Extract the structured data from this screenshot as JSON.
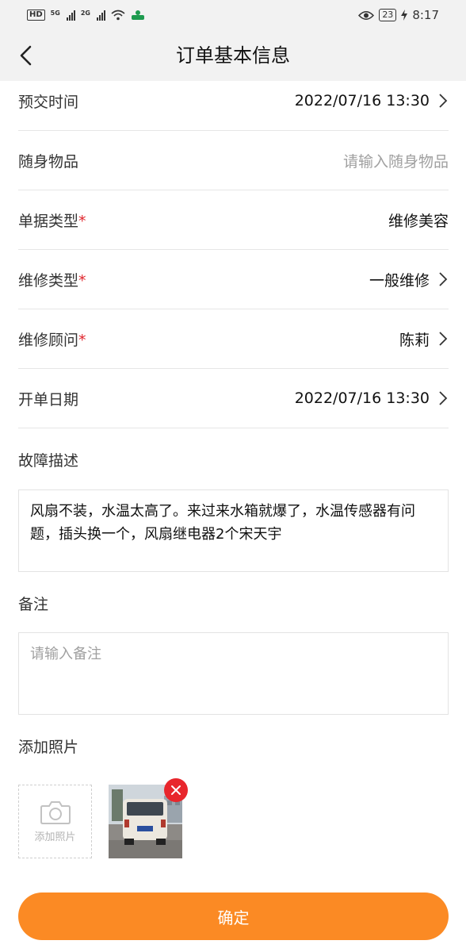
{
  "status_bar": {
    "hd": "HD",
    "net1": "5G",
    "net2": "2G",
    "battery": "23",
    "time": "8:17",
    "icons": [
      "eye-icon",
      "wifi-icon",
      "charging-icon"
    ]
  },
  "header": {
    "title": "订单基本信息",
    "back_icon": "chevron-left-icon"
  },
  "rows": [
    {
      "label": "预交时间",
      "required": false,
      "value": "2022/07/16 13:30",
      "placeholder": false,
      "chevron": true
    },
    {
      "label": "随身物品",
      "required": false,
      "value": "请输入随身物品",
      "placeholder": true,
      "chevron": false
    },
    {
      "label": "单据类型",
      "required": true,
      "value": "维修美容",
      "placeholder": false,
      "chevron": false
    },
    {
      "label": "维修类型",
      "required": true,
      "value": "一般维修",
      "placeholder": false,
      "chevron": true
    },
    {
      "label": "维修顾问",
      "required": true,
      "value": "陈莉",
      "placeholder": false,
      "chevron": true
    },
    {
      "label": "开单日期",
      "required": false,
      "value": "2022/07/16 13:30",
      "placeholder": false,
      "chevron": true
    }
  ],
  "required_mark": "*",
  "fault": {
    "label": "故障描述",
    "value": "风扇不装，水温太高了。来过来水箱就爆了，水温传感器有问题，插头换一个，风扇继电器2个宋天宇"
  },
  "remark": {
    "label": "备注",
    "placeholder": "请输入备注"
  },
  "photos": {
    "label": "添加照片",
    "add_label": "添加照片",
    "add_icon": "camera-icon",
    "delete_icon": "close-icon"
  },
  "confirm_label": "确定",
  "colors": {
    "accent": "#fb8a24",
    "required": "#e0252c",
    "delete": "#e8262c",
    "placeholder": "#a0a0a0"
  }
}
